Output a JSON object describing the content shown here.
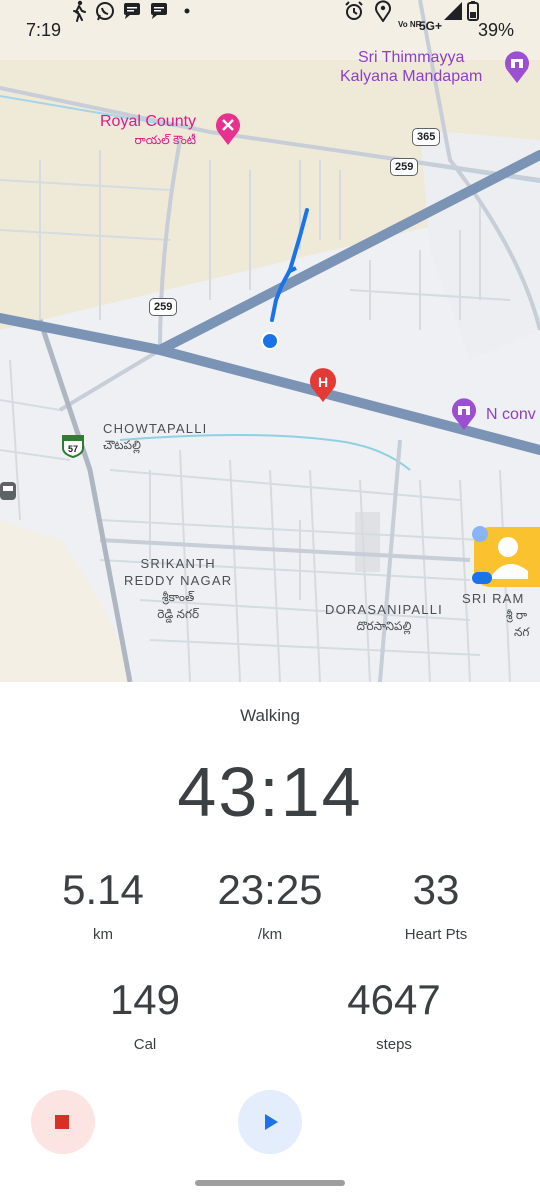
{
  "status_bar": {
    "time": "7:19",
    "battery": "39%",
    "network": "5G+",
    "volte": "Vo NR",
    "left_icons": [
      "walking-icon",
      "whatsapp-icon",
      "chat-bubble-icon",
      "chat-bubble-icon",
      "dot-icon"
    ],
    "right_icons": [
      "alarm-icon",
      "location-icon",
      "signal-icon",
      "battery-icon"
    ]
  },
  "map": {
    "pois": [
      {
        "name": "Royal County",
        "sub": "రాయల్ కౌంటీ"
      },
      {
        "name": "Sri Thimmayya",
        "name2": "Kalyana Mandapam"
      },
      {
        "name": "N conv"
      }
    ],
    "places": [
      {
        "name": "CHOWTAPALLI",
        "sub": "చౌటపల్లి"
      },
      {
        "name": "SRIKANTH",
        "name2": "REDDY NAGAR",
        "sub": "శ్రీకాంత్",
        "sub2": "రెడ్డి నగర్"
      },
      {
        "name": "DORASANIPALLI",
        "sub": "దొరసానిపల్లి"
      },
      {
        "name": "SRI RAM",
        "sub": "శ్రీ రా",
        "sub2": "నగ"
      }
    ],
    "route_shields": [
      "365",
      "259",
      "259"
    ],
    "highway_shield": "57"
  },
  "workout": {
    "activity": "Walking",
    "duration": "43:14",
    "stats": [
      {
        "value": "5.14",
        "label": "km"
      },
      {
        "value": "23:25",
        "label": "/km"
      },
      {
        "value": "33",
        "label": "Heart Pts"
      },
      {
        "value": "149",
        "label": "Cal"
      },
      {
        "value": "4647",
        "label": "steps"
      }
    ]
  },
  "controls": {
    "stop": "stop-icon",
    "play": "play-icon"
  },
  "colors": {
    "stop_bg": "#fbe4e2",
    "stop_icon": "#d93025",
    "play_bg": "#e3edfc",
    "play_icon": "#1a73e8",
    "route": "#1a73e8",
    "poi_pink": "#d81b8c",
    "poi_purple": "#8e3fc7"
  }
}
